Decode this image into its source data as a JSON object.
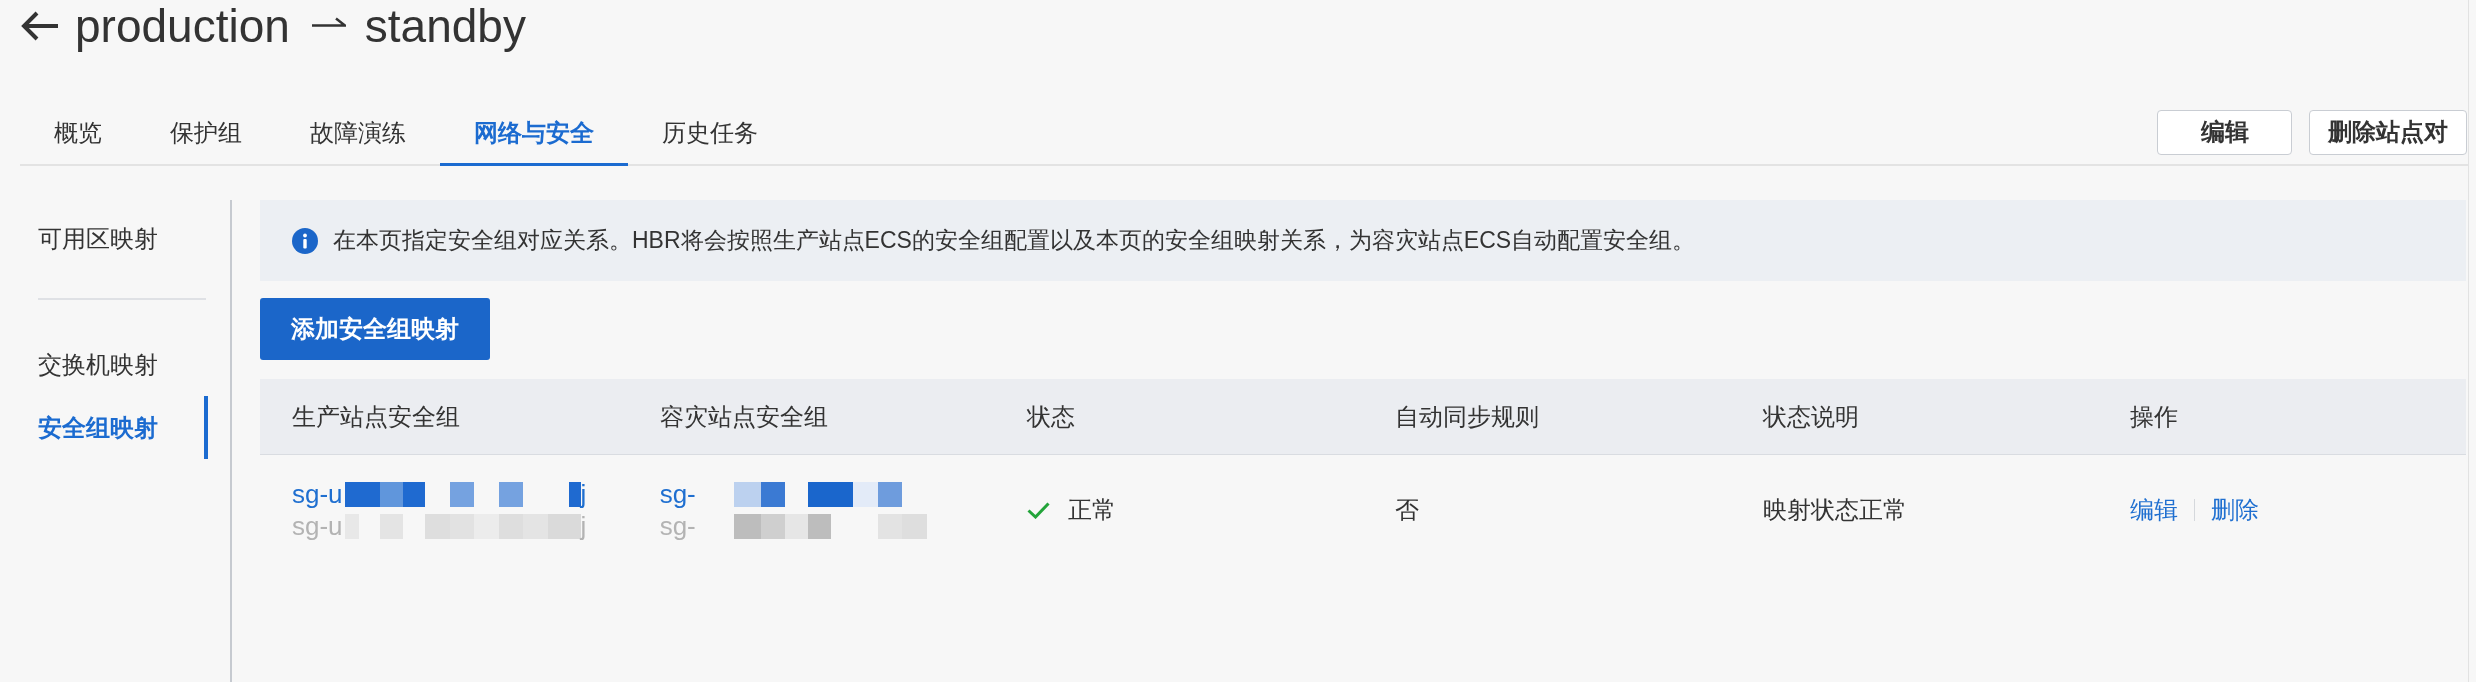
{
  "header": {
    "source": "production",
    "target": "standby"
  },
  "tabs": [
    {
      "label": "概览",
      "selected": false
    },
    {
      "label": "保护组",
      "selected": false
    },
    {
      "label": "故障演练",
      "selected": false
    },
    {
      "label": "网络与安全",
      "selected": true
    },
    {
      "label": "历史任务",
      "selected": false
    }
  ],
  "header_buttons": [
    "编辑",
    "删除站点对"
  ],
  "sidebar": {
    "groups": [
      [
        {
          "label": "可用区映射",
          "selected": false
        }
      ],
      [
        {
          "label": "交换机映射",
          "selected": false
        },
        {
          "label": "安全组映射",
          "selected": true
        }
      ]
    ]
  },
  "notice": {
    "text": "在本页指定安全组对应关系。HBR将会按照生产站点ECS的安全组配置以及本页的安全组映射关系，为容灾站点ECS自动配置安全组。"
  },
  "add_button": "添加安全组映射",
  "table": {
    "columns": [
      "生产站点安全组",
      "容灾站点安全组",
      "状态",
      "自动同步规则",
      "状态说明",
      "操作"
    ],
    "rows": [
      {
        "source_group": {
          "id": {
            "start": "sg-u",
            "end": "j",
            "redacted": true
          },
          "name": {
            "start": "sg-u",
            "end": "j",
            "redacted": true
          }
        },
        "target_group": {
          "id": {
            "start": "sg-",
            "redacted": true
          },
          "name": {
            "start": "sg-",
            "redacted": true
          }
        },
        "status": {
          "kind": "ok",
          "label": "正常"
        },
        "auto_sync": "否",
        "status_note": "映射状态正常",
        "actions": [
          "编辑",
          "删除"
        ]
      }
    ]
  }
}
